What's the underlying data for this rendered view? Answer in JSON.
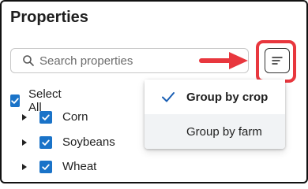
{
  "panel": {
    "title": "Properties",
    "search": {
      "placeholder": "Search properties",
      "value": ""
    }
  },
  "tree": {
    "select_all_label": "Select All",
    "items": [
      {
        "label": "Corn",
        "checked": true
      },
      {
        "label": "Soybeans",
        "checked": true
      },
      {
        "label": "Wheat",
        "checked": true
      }
    ]
  },
  "sort_menu": {
    "items": [
      {
        "label": "Group by crop",
        "selected": true
      },
      {
        "label": "Group by farm",
        "selected": false
      }
    ]
  },
  "colors": {
    "accent": "#1a73c8",
    "highlight": "#e8373e",
    "menu_hover": "#f1f3f5"
  },
  "icons": [
    "search-icon",
    "sort-icon",
    "checkmark-icon",
    "chevron-right-icon",
    "arrow-right-icon"
  ]
}
